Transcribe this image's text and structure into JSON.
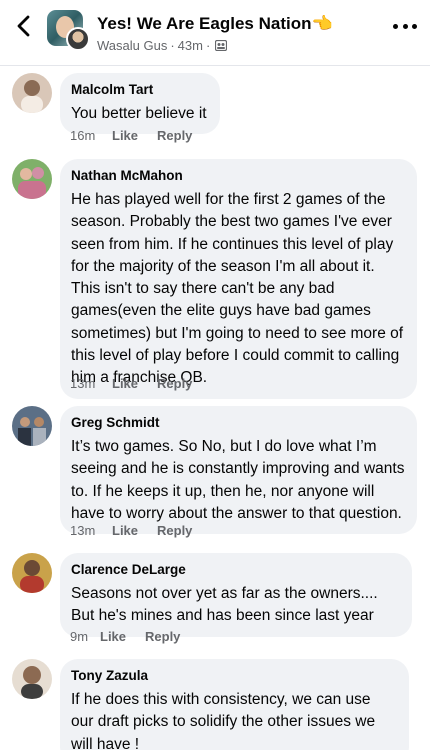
{
  "header": {
    "group_name": "Yes! We Are Eagles Nation👈",
    "author": "Wasalu Gus",
    "time": "43m",
    "separator": "·"
  },
  "comments": [
    {
      "name": "Malcolm Tart",
      "text": "You better believe it",
      "time": "16m",
      "like_label": "Like",
      "reply_label": "Reply"
    },
    {
      "name": "Nathan McMahon",
      "text": "He has played well for the first 2 games of the season. Probably the best two games I've ever seen from him. If he continues this level of play for the majority of the season I'm all about it. This isn't to say there can't be any bad games(even the elite guys have bad games sometimes) but I'm going to need to see more of this level of play before I could commit to calling him a franchise QB.",
      "time": "13m",
      "like_label": "Like",
      "reply_label": "Reply"
    },
    {
      "name": "Greg Schmidt",
      "text": "It’s two games. So No, but I do love what I’m seeing and he is constantly improving and wants to. If he keeps it up, then he, nor anyone will have to worry about the answer to that question.",
      "time": "13m",
      "like_label": "Like",
      "reply_label": "Reply"
    },
    {
      "name": "Clarence DeLarge",
      "text": "Seasons not over yet as far as the owners.... But he's mines and has been since last year",
      "time": "9m",
      "like_label": "Like",
      "reply_label": "Reply"
    },
    {
      "name": "Tony Zazula",
      "text": "If he does this with consistency, we can use our draft picks to solidify the other issues we will have !",
      "time": "",
      "like_label": "",
      "reply_label": ""
    }
  ],
  "icons": {
    "back": "chevron-left-icon",
    "more": "more-dots-icon",
    "audience": "group-members-icon"
  },
  "colors": {
    "bubble": "#f0f2f5",
    "secondary_text": "#65676b",
    "primary_text": "#050505"
  }
}
